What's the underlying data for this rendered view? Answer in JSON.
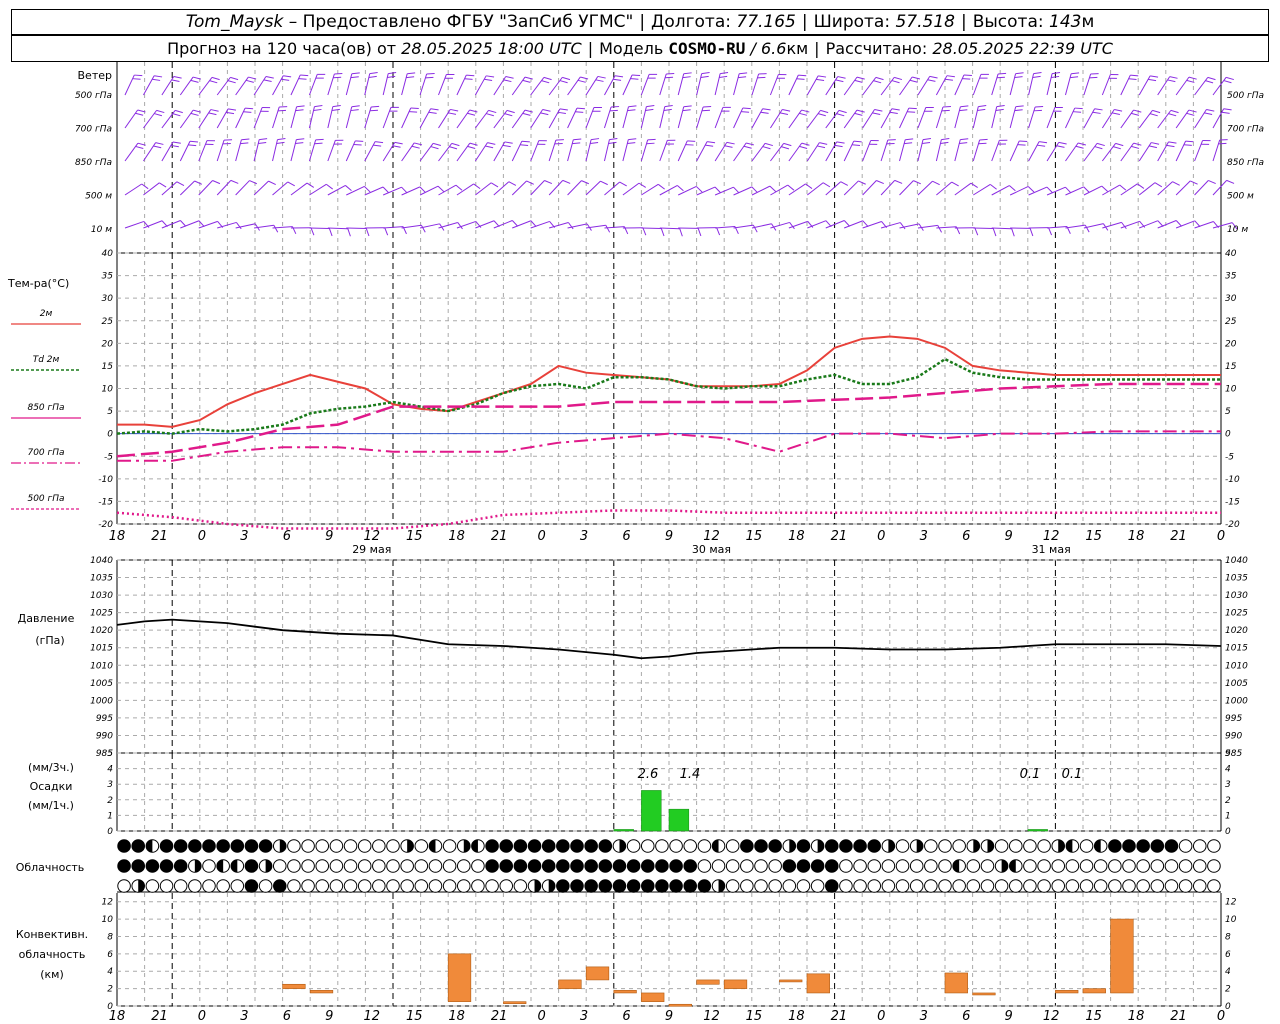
{
  "header": {
    "station": "Tom_Maysk",
    "provider": "– Предоставлено ФГБУ \"ЗапСиб УГМС\"",
    "lon_label": "Долгота:",
    "lon": "77.165",
    "lat_label": "Широта:",
    "lat": "57.518",
    "alt_label": "Высота:",
    "alt": "143",
    "alt_unit": "м",
    "fc_label": "Прогноз на 120 часа(ов) от",
    "fc_time": "28.05.2025 18:00 UTC",
    "model_label": "Модель",
    "model": "COSMO-RU",
    "model_res": "/ 6.6",
    "model_res_unit": "км",
    "calc_label": "Рассчитано:",
    "calc_time": "28.05.2025 22:39 UTC"
  },
  "colors": {
    "wind": "#8a2be2",
    "t2m": "#e8413a",
    "td2m": "#1a7a1a",
    "t850": "#e0198a",
    "t700": "#e0198a",
    "t500": "#e0198a",
    "pressure": "#000000",
    "precip": "#22cc22",
    "convective": "#f08a3a",
    "grid": "#aaaaaa"
  },
  "wind_panel": {
    "title": "Ветер",
    "levels": [
      "500 гПа",
      "700 гПа",
      "850 гПа",
      "500 м",
      "10  м"
    ]
  },
  "temp_panel": {
    "title": "Тем-ра(°С)",
    "legend": [
      {
        "label": "2м"
      },
      {
        "label": "Td  2м"
      },
      {
        "label": "850 гПа"
      },
      {
        "label": "700 гПа"
      },
      {
        "label": "500 гПа"
      }
    ],
    "yticks": [
      40,
      35,
      30,
      25,
      20,
      15,
      10,
      5,
      0,
      -5,
      -10,
      -15,
      -20
    ]
  },
  "pressure_panel": {
    "title": "Давление",
    "unit": "(гПа)",
    "yticks": [
      1040,
      1035,
      1030,
      1025,
      1020,
      1015,
      1010,
      1005,
      1000,
      995,
      990,
      985
    ]
  },
  "precip_panel": {
    "unit1": "(мм/3ч.)",
    "title": "Осадки",
    "unit2": "(мм/1ч.)",
    "yticks": [
      5,
      4,
      3,
      2,
      1,
      0
    ],
    "annotations": [
      "2.6",
      "1.4",
      "0.1",
      "0.1"
    ]
  },
  "cloud_panel": {
    "title": "Облачность"
  },
  "conv_panel": {
    "title1": "Конвективн.",
    "title2": "облачность",
    "unit": "(км)",
    "yticks": [
      12,
      10,
      8,
      6,
      4,
      2,
      0
    ]
  },
  "axis": {
    "hour_labels": [
      "18",
      "21",
      "0",
      "3",
      "6",
      "9",
      "12",
      "15",
      "18",
      "21",
      "0",
      "3",
      "6",
      "9",
      "12",
      "15",
      "18",
      "21",
      "0",
      "3",
      "6",
      "9",
      "12",
      "15",
      "18",
      "21",
      "0"
    ],
    "dates": [
      "29 мая",
      "30 мая",
      "31 мая"
    ]
  },
  "chart_data": [
    {
      "type": "line",
      "title": "Тем-ра(°С)",
      "x_unit": "hours since 28.05.2025 18:00 UTC",
      "ylim": [
        -20,
        40
      ],
      "series": [
        {
          "name": "2м",
          "x": [
            0,
            3,
            6,
            9,
            12,
            15,
            18,
            21,
            24,
            27,
            30,
            33,
            36,
            39,
            42,
            45,
            48,
            51,
            54,
            57,
            60,
            63,
            66,
            69,
            72,
            75,
            78,
            81,
            84,
            87,
            90,
            93,
            96,
            99,
            102,
            105,
            108,
            111,
            114,
            117,
            120
          ],
          "values": [
            2,
            2,
            1.5,
            3,
            6.5,
            9,
            11,
            13,
            11.5,
            10,
            6.5,
            5.5,
            5,
            7,
            9,
            11,
            15,
            13.5,
            13,
            12.5,
            12,
            10.5,
            10.5,
            10.5,
            11,
            14,
            19,
            21,
            21.5,
            21,
            19,
            15,
            14,
            13.5,
            13,
            13,
            13,
            13,
            13,
            13,
            13
          ]
        },
        {
          "name": "Td  2м",
          "x": [
            0,
            3,
            6,
            9,
            12,
            15,
            18,
            21,
            24,
            27,
            30,
            33,
            36,
            39,
            42,
            45,
            48,
            51,
            54,
            57,
            60,
            63,
            66,
            69,
            72,
            75,
            78,
            81,
            84,
            87,
            90,
            93,
            96,
            99,
            102,
            105,
            108,
            111,
            114,
            117,
            120
          ],
          "values": [
            0,
            0.5,
            0,
            1,
            0.5,
            1,
            2,
            4.5,
            5.5,
            6,
            7,
            6,
            5,
            6.5,
            9,
            10.5,
            11,
            10,
            12.5,
            12.5,
            12,
            10.5,
            10,
            10.5,
            10.5,
            12,
            13,
            11,
            11,
            12.5,
            16.5,
            13.5,
            12.5,
            12,
            12,
            12,
            12,
            12,
            12,
            12,
            12
          ]
        },
        {
          "name": "850 гПа",
          "x": [
            0,
            6,
            12,
            18,
            24,
            30,
            36,
            42,
            48,
            54,
            60,
            66,
            72,
            78,
            84,
            90,
            96,
            102,
            108,
            114,
            120
          ],
          "values": [
            -5,
            -4,
            -2,
            1,
            2,
            6,
            6,
            6,
            6,
            7,
            7,
            7,
            7,
            7.5,
            8,
            9,
            10,
            10.5,
            11,
            11,
            11
          ]
        },
        {
          "name": "700 гПа",
          "x": [
            0,
            6,
            12,
            18,
            24,
            30,
            36,
            42,
            48,
            54,
            60,
            66,
            72,
            78,
            84,
            90,
            96,
            102,
            108,
            114,
            120
          ],
          "values": [
            -6,
            -6,
            -4,
            -3,
            -3,
            -4,
            -4,
            -4,
            -2,
            -1,
            0,
            -1,
            -4,
            0,
            0,
            -1,
            0,
            0,
            0.5,
            0.5,
            0.5
          ]
        },
        {
          "name": "500 гПа",
          "x": [
            0,
            6,
            12,
            18,
            24,
            30,
            36,
            42,
            48,
            54,
            60,
            66,
            72,
            78,
            84,
            90,
            96,
            102,
            108,
            114,
            120
          ],
          "values": [
            -17.5,
            -18.5,
            -20,
            -21,
            -21,
            -21,
            -20,
            -18,
            -17.5,
            -17,
            -17,
            -17.5,
            -17.5,
            -17.5,
            -17.5,
            -17.5,
            -17.5,
            -17.5,
            -17.5,
            -17.5,
            -17.5
          ]
        }
      ]
    },
    {
      "type": "line",
      "title": "Давление",
      "ylim": [
        985,
        1040
      ],
      "series": [
        {
          "name": "Давление",
          "x": [
            0,
            3,
            6,
            9,
            12,
            18,
            24,
            30,
            36,
            42,
            48,
            54,
            57,
            60,
            63,
            66,
            72,
            78,
            84,
            90,
            96,
            102,
            108,
            114,
            120
          ],
          "values": [
            1021.5,
            1022.5,
            1023,
            1022.5,
            1022,
            1020,
            1019,
            1018.5,
            1016,
            1015.5,
            1014.5,
            1013,
            1012,
            1012.5,
            1013.5,
            1014,
            1015,
            1015,
            1014.5,
            1014.5,
            1015,
            1016,
            1016,
            1016,
            1015.5
          ]
        }
      ]
    },
    {
      "type": "bar",
      "title": "Осадки",
      "ylim": [
        0,
        5
      ],
      "x": [
        54,
        57,
        60,
        99
      ],
      "values": [
        0.1,
        2.6,
        1.4,
        0.1
      ]
    },
    {
      "type": "bar",
      "title": "Конвективн. облачность",
      "ylim": [
        0,
        13
      ],
      "x": [
        18,
        21,
        36,
        42,
        48,
        51,
        54,
        57,
        60,
        63,
        66,
        72,
        75,
        90,
        93,
        102,
        105,
        108
      ],
      "base": [
        2,
        1.5,
        0.5,
        0.5,
        2,
        3,
        1.5,
        0.5,
        0.2,
        2.5,
        2,
        2.8,
        1.5,
        1.5,
        1.5,
        1.5,
        1.5,
        1.5
      ],
      "top": [
        2.5,
        1.8,
        6,
        0.5,
        3,
        4.5,
        1.8,
        1.5,
        0.2,
        3,
        3,
        3,
        3.7,
        3.8,
        1.5,
        1.8,
        2,
        10
      ]
    }
  ]
}
